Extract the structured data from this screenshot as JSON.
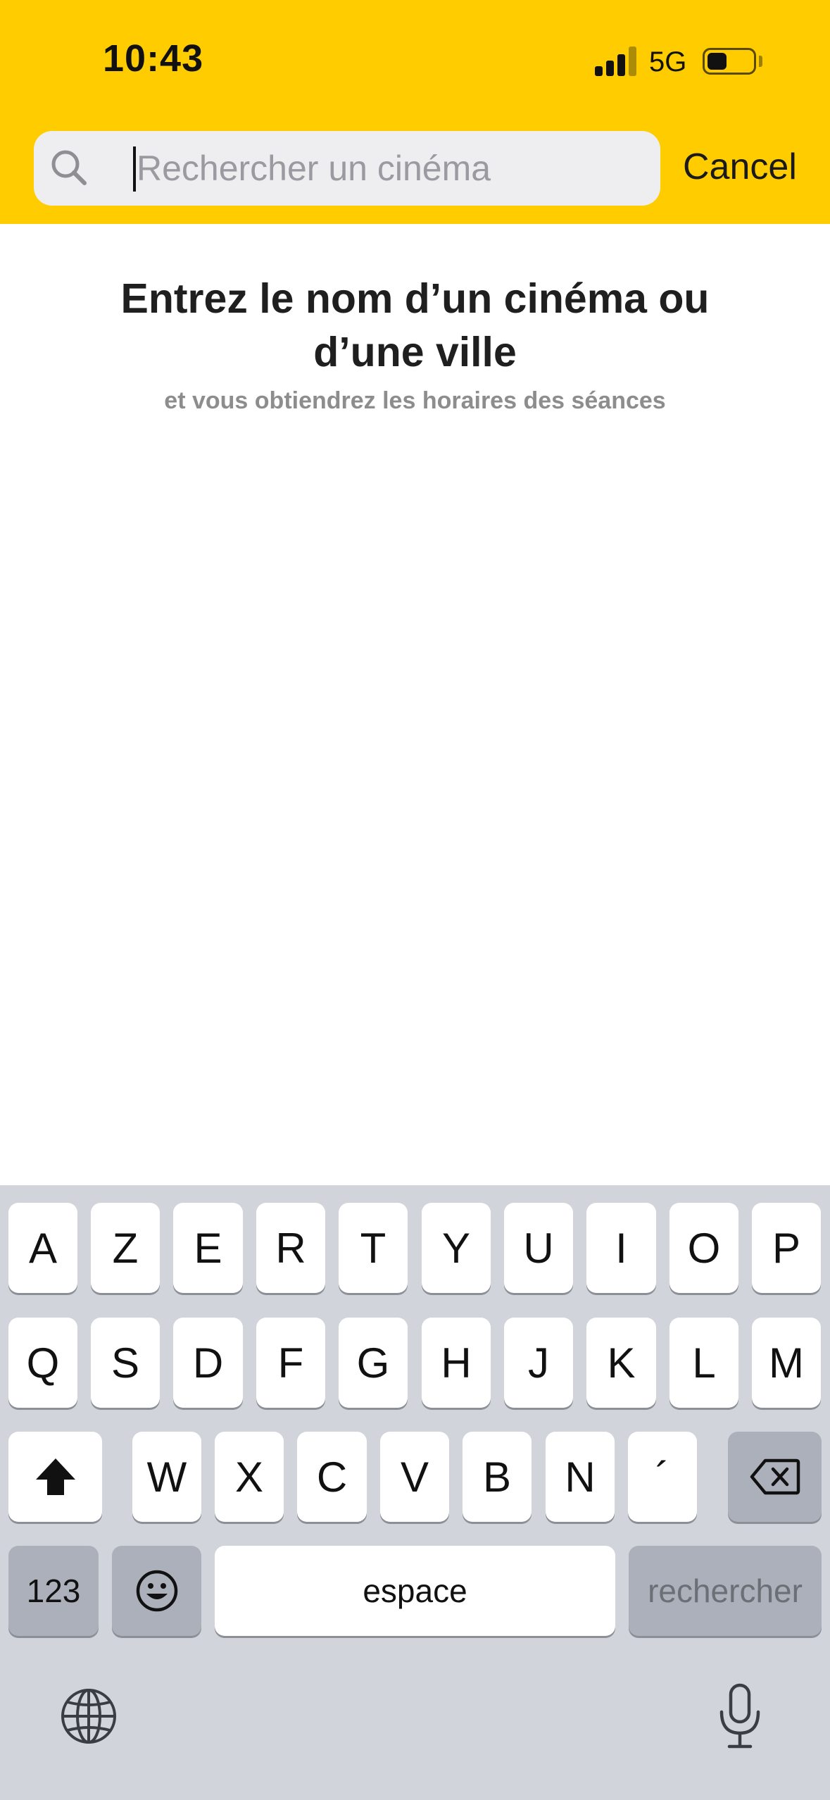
{
  "status_bar": {
    "time": "10:43",
    "network": "5G",
    "icons": [
      "signal-icon",
      "battery-icon"
    ]
  },
  "search": {
    "placeholder": "Rechercher un cinéma",
    "value": "",
    "cancel_label": "Cancel",
    "icon": "search-icon"
  },
  "content": {
    "headline_line1": "Entrez le nom d’un cinéma ou",
    "headline_line2": "d’une ville",
    "subline": "et vous obtiendrez les horaires des séances"
  },
  "keyboard": {
    "row1": [
      "A",
      "Z",
      "E",
      "R",
      "T",
      "Y",
      "U",
      "I",
      "O",
      "P"
    ],
    "row2": [
      "Q",
      "S",
      "D",
      "F",
      "G",
      "H",
      "J",
      "K",
      "L",
      "M"
    ],
    "row3": [
      "W",
      "X",
      "C",
      "V",
      "B",
      "N",
      "´"
    ],
    "numbers_label": "123",
    "space_label": "espace",
    "return_label": "rechercher",
    "icons": [
      "shift-icon",
      "backspace-icon",
      "emoji-icon",
      "globe-icon",
      "microphone-icon"
    ]
  },
  "colors": {
    "header": "#FFCC00",
    "keyboard_bg": "#D1D4DB",
    "key": "#FFFFFF",
    "key_dark": "#ABB0BA"
  }
}
